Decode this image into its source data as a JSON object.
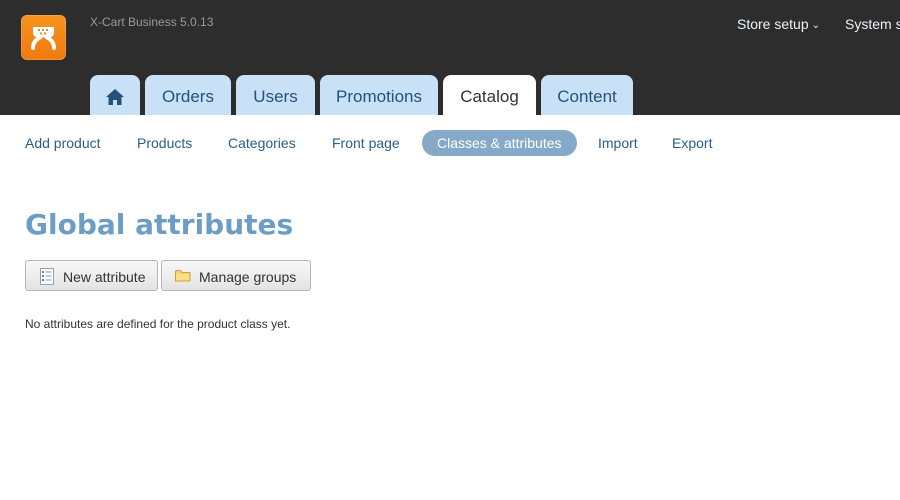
{
  "app": {
    "logo_icon": "xcart-logo-icon",
    "version": "X-Cart Business 5.0.13",
    "brand_color": "#f7941d",
    "header_color": "#2d2d2d"
  },
  "top_nav": [
    {
      "label": "Store setup",
      "icon": "chevron-down-icon"
    },
    {
      "label": "System s"
    }
  ],
  "main_tabs": [
    {
      "label": "",
      "icon": "home-icon",
      "active": false
    },
    {
      "label": "Orders",
      "active": false
    },
    {
      "label": "Users",
      "active": false
    },
    {
      "label": "Promotions",
      "active": false
    },
    {
      "label": "Catalog",
      "active": true
    },
    {
      "label": "Content",
      "active": false
    }
  ],
  "sub_nav": [
    {
      "label": "Add product",
      "active": false
    },
    {
      "label": "Products",
      "active": false
    },
    {
      "label": "Categories",
      "active": false
    },
    {
      "label": "Front page",
      "active": false
    },
    {
      "label": "Classes & attributes",
      "active": true
    },
    {
      "label": "Import",
      "active": false
    },
    {
      "label": "Export",
      "active": false
    }
  ],
  "page": {
    "title": "Global attributes",
    "buttons": [
      {
        "label": "New attribute",
        "icon": "document-list-icon"
      },
      {
        "label": "Manage groups",
        "icon": "folder-icon"
      }
    ],
    "empty_message": "No attributes are defined for the product class yet."
  },
  "colors": {
    "tab_inactive": "#c8e1f6",
    "subnav_active": "#85a9c8",
    "title": "#6c9dc5"
  }
}
